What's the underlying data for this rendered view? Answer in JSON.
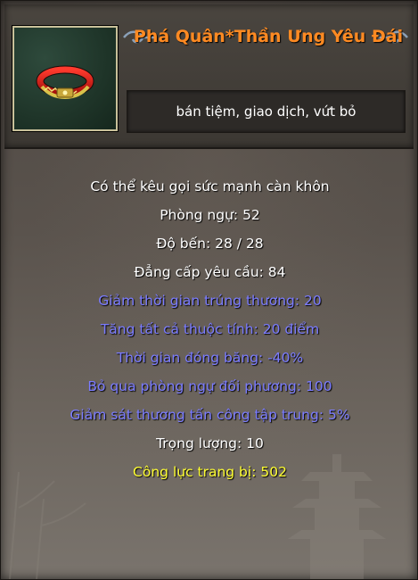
{
  "item": {
    "name": "Phá Quân*Thần Ưng Yêu Đái",
    "restrictions": "bán tiệm, giao dịch, vứt bỏ",
    "icon": "red-belt-icon",
    "colors": {
      "name": "#ff8a22",
      "white_stat": "#ffffff",
      "bonus_stat": "#7b7cff",
      "power_stat": "#ffff33"
    }
  },
  "stats": [
    {
      "text": "Có thể kêu gọi sức mạnh càn khôn",
      "color": "white"
    },
    {
      "text": "Phòng ngự: 52",
      "color": "white"
    },
    {
      "text": "Độ bến:  28 /  28",
      "color": "white"
    },
    {
      "text": "Đẳng cấp yêu cầu: 84",
      "color": "white"
    },
    {
      "text": "Giảm thời gian trúng thương: 20",
      "color": "blue"
    },
    {
      "text": "Tăng tất cả thuộc tính: 20 điểm",
      "color": "blue"
    },
    {
      "text": "Thời gian đóng băng: -40%",
      "color": "blue"
    },
    {
      "text": "Bỏ qua phòng ngự đối phương: 100",
      "color": "blue"
    },
    {
      "text": "Giảm sát thương tấn công tập trung: 5%",
      "color": "blue"
    },
    {
      "text": "Trọng lượng: 10",
      "color": "white"
    },
    {
      "text": "Công lực trang bị: 502",
      "color": "yellow"
    }
  ]
}
